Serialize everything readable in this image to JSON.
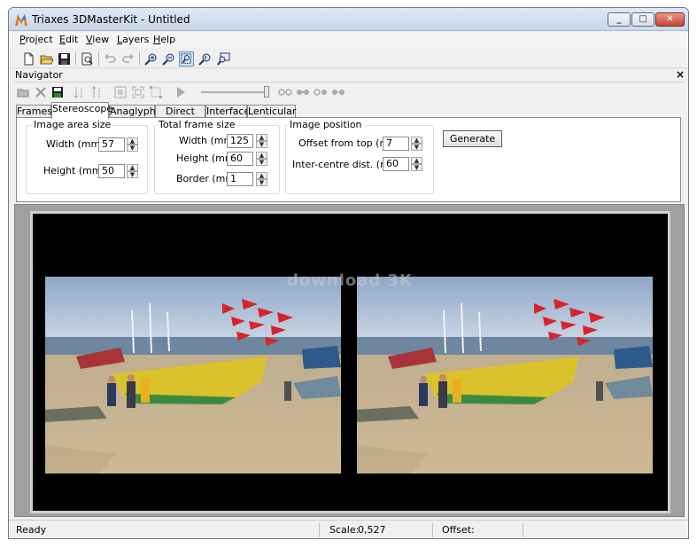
{
  "window": {
    "title": "Triaxes 3DMasterKit - Untitled"
  },
  "menu": [
    {
      "accel": "P",
      "rest": "roject"
    },
    {
      "accel": "E",
      "rest": "dit"
    },
    {
      "accel": "V",
      "rest": "iew"
    },
    {
      "accel": "L",
      "rest": "ayers"
    },
    {
      "accel": "H",
      "rest": "elp"
    }
  ],
  "navigator": {
    "title": "Navigator",
    "close": "×"
  },
  "tabs": [
    "Frames",
    "Stereoscope",
    "Anaglyph",
    "Direct view",
    "Interface",
    "Lenticular"
  ],
  "stereoscope": {
    "image_area": {
      "title": "Image area size",
      "width_label": "Width  (mm)",
      "width_value": "57",
      "height_label": "Height  (mm)",
      "height_value": "50"
    },
    "total_frame": {
      "title": "Total frame size",
      "width_label": "Width (mm)",
      "width_value": "125",
      "height_label": "Height (mm)",
      "height_value": "60",
      "border_label": "Border (mm)",
      "border_value": "1"
    },
    "image_position": {
      "title": "Image position",
      "offset_label": "Offset from top (mm)",
      "offset_value": "7",
      "intercentre_label": "Inter-centre dist. (mm)",
      "intercentre_value": "60"
    },
    "generate_label": "Generate"
  },
  "canvas": {
    "watermark": "download 3K"
  },
  "status": {
    "state": "Ready",
    "scale_label": "Scale:",
    "scale_value": "0,527",
    "offset_label": "Offset:"
  }
}
